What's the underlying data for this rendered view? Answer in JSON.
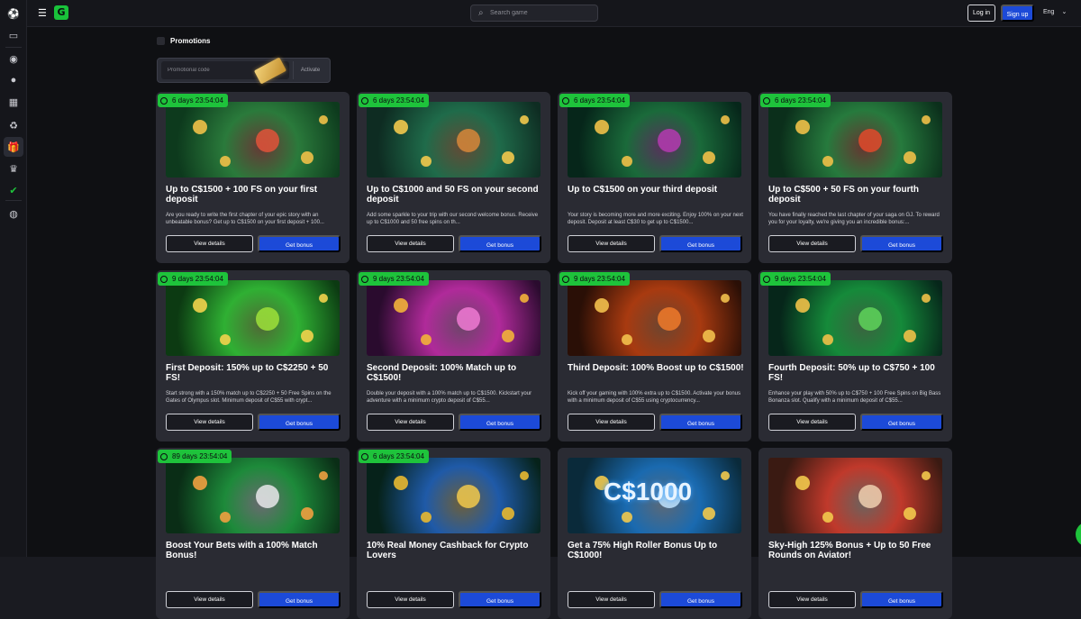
{
  "header": {
    "search_placeholder": "Search game",
    "login_label": "Log in",
    "signup_label": "Sign up",
    "language": "Eng"
  },
  "page": {
    "title": "Promotions",
    "promo_placeholder": "Promotional code",
    "activate_label": "Activate"
  },
  "cards": [
    {
      "timer": "6 days 23:54:04",
      "title": "Up to C$1500 + 100 FS on your first deposit",
      "desc": "Are you ready to write the first chapter of your epic story with an unbeatable bonus? Get up to C$1500 on your first deposit + 100...",
      "view": "View details",
      "get": "Get bonus",
      "colors": [
        "#0d3a1d",
        "#2a7a3b",
        "#e0533a",
        "#f0c048"
      ]
    },
    {
      "timer": "6 days 23:54:04",
      "title": "Up to C$1000 and 50 FS on your second deposit",
      "desc": "Add some sparkle to your trip with our second welcome bonus. Receive up to C$1000 and 50 free spins on th...",
      "view": "View details",
      "get": "Get bonus",
      "colors": [
        "#0e2c22",
        "#1f6b4a",
        "#d7873a",
        "#f2c94c"
      ]
    },
    {
      "timer": "6 days 23:54:04",
      "title": "Up to C$1500 on your third deposit",
      "desc": "Your story is becoming more and more exciting. Enjoy 100% on your next deposit. Deposit at least C$30 to get up to C$1500...",
      "view": "View details",
      "get": "Get bonus",
      "colors": [
        "#06261a",
        "#1a6a3a",
        "#b43bb0",
        "#f0c048"
      ]
    },
    {
      "timer": "6 days 23:54:04",
      "title": "Up to C$500 + 50 FS on your fourth deposit",
      "desc": "You have finally reached the last chapter of your saga on GJ. To reward you for your loyalty, we're giving you an incredible bonus:...",
      "view": "View details",
      "get": "Get bonus",
      "colors": [
        "#0b2f1b",
        "#267a3d",
        "#e04a2c",
        "#f0c048"
      ]
    },
    {
      "timer": "9 days 23:54:04",
      "title": "First Deposit: 150% up to C$2250 + 50 FS!",
      "desc": "Start strong with a 150% match up to C$2250 + 50 Free Spins on the Gates of Olympus slot. Minimum deposit of C$55 with crypt...",
      "view": "View details",
      "get": "Get bonus",
      "colors": [
        "#0c3a12",
        "#2fb033",
        "#9de23a",
        "#f2d34c"
      ]
    },
    {
      "timer": "9 days 23:54:04",
      "title": "Second Deposit: 100% Match up to C$1500!",
      "desc": "Double your deposit with a 100% match up to C$1500. Kickstart your adventure with a minimum crypto deposit of C$55...",
      "view": "View details",
      "get": "Get bonus",
      "colors": [
        "#2a0b2e",
        "#b02a9a",
        "#f07ad4",
        "#f2b13a"
      ]
    },
    {
      "timer": "9 days 23:54:04",
      "title": "Third Deposit: 100% Boost up to C$1500!",
      "desc": "Kick off your gaming with 100% extra up to C$1500. Activate your bonus with a minimum deposit of C$55 using cryptocurrency...",
      "view": "View details",
      "get": "Get bonus",
      "colors": [
        "#2a0f06",
        "#a83a10",
        "#f07a2a",
        "#f2c04c"
      ]
    },
    {
      "timer": "9 days 23:54:04",
      "title": "Fourth Deposit: 50% up to C$750 + 100 FS!",
      "desc": "Enhance your play with 50% up to C$750 + 100 Free Spins on Big Bass Bonanza slot. Qualify with a minimum deposit of C$55...",
      "view": "View details",
      "get": "Get bonus",
      "colors": [
        "#06261a",
        "#158a3a",
        "#5fd35a",
        "#f0c048"
      ]
    },
    {
      "timer": "89 days 23:54:04",
      "title": "Boost Your Bets with a 100% Match Bonus!",
      "desc": "",
      "view": "View details",
      "get": "Get bonus",
      "colors": [
        "#0a2d16",
        "#1d8a3a",
        "#e8e8ea",
        "#f0a040"
      ]
    },
    {
      "timer": "6 days 23:54:04",
      "title": "10% Real Money Cashback for Crypto Lovers",
      "desc": "",
      "view": "View details",
      "get": "Get bonus",
      "colors": [
        "#06221a",
        "#1f5aa8",
        "#f2c94c",
        "#e8b830"
      ]
    },
    {
      "timer": "",
      "title": "Get a 75% High Roller Bonus Up to C$1000!",
      "desc": "",
      "view": "View details",
      "get": "Get bonus",
      "colors": [
        "#0a2a3a",
        "#1a6ab0",
        "#bfe4ff",
        "#f2c94c"
      ]
    },
    {
      "timer": "",
      "title": "Sky-High 125% Bonus + Up to 50 Free Rounds on Aviator!",
      "desc": "",
      "view": "View details",
      "get": "Get bonus",
      "colors": [
        "#3a1a12",
        "#c0392b",
        "#f0d0b0",
        "#f2c94c"
      ]
    }
  ],
  "card3_art_text": "C$1000"
}
